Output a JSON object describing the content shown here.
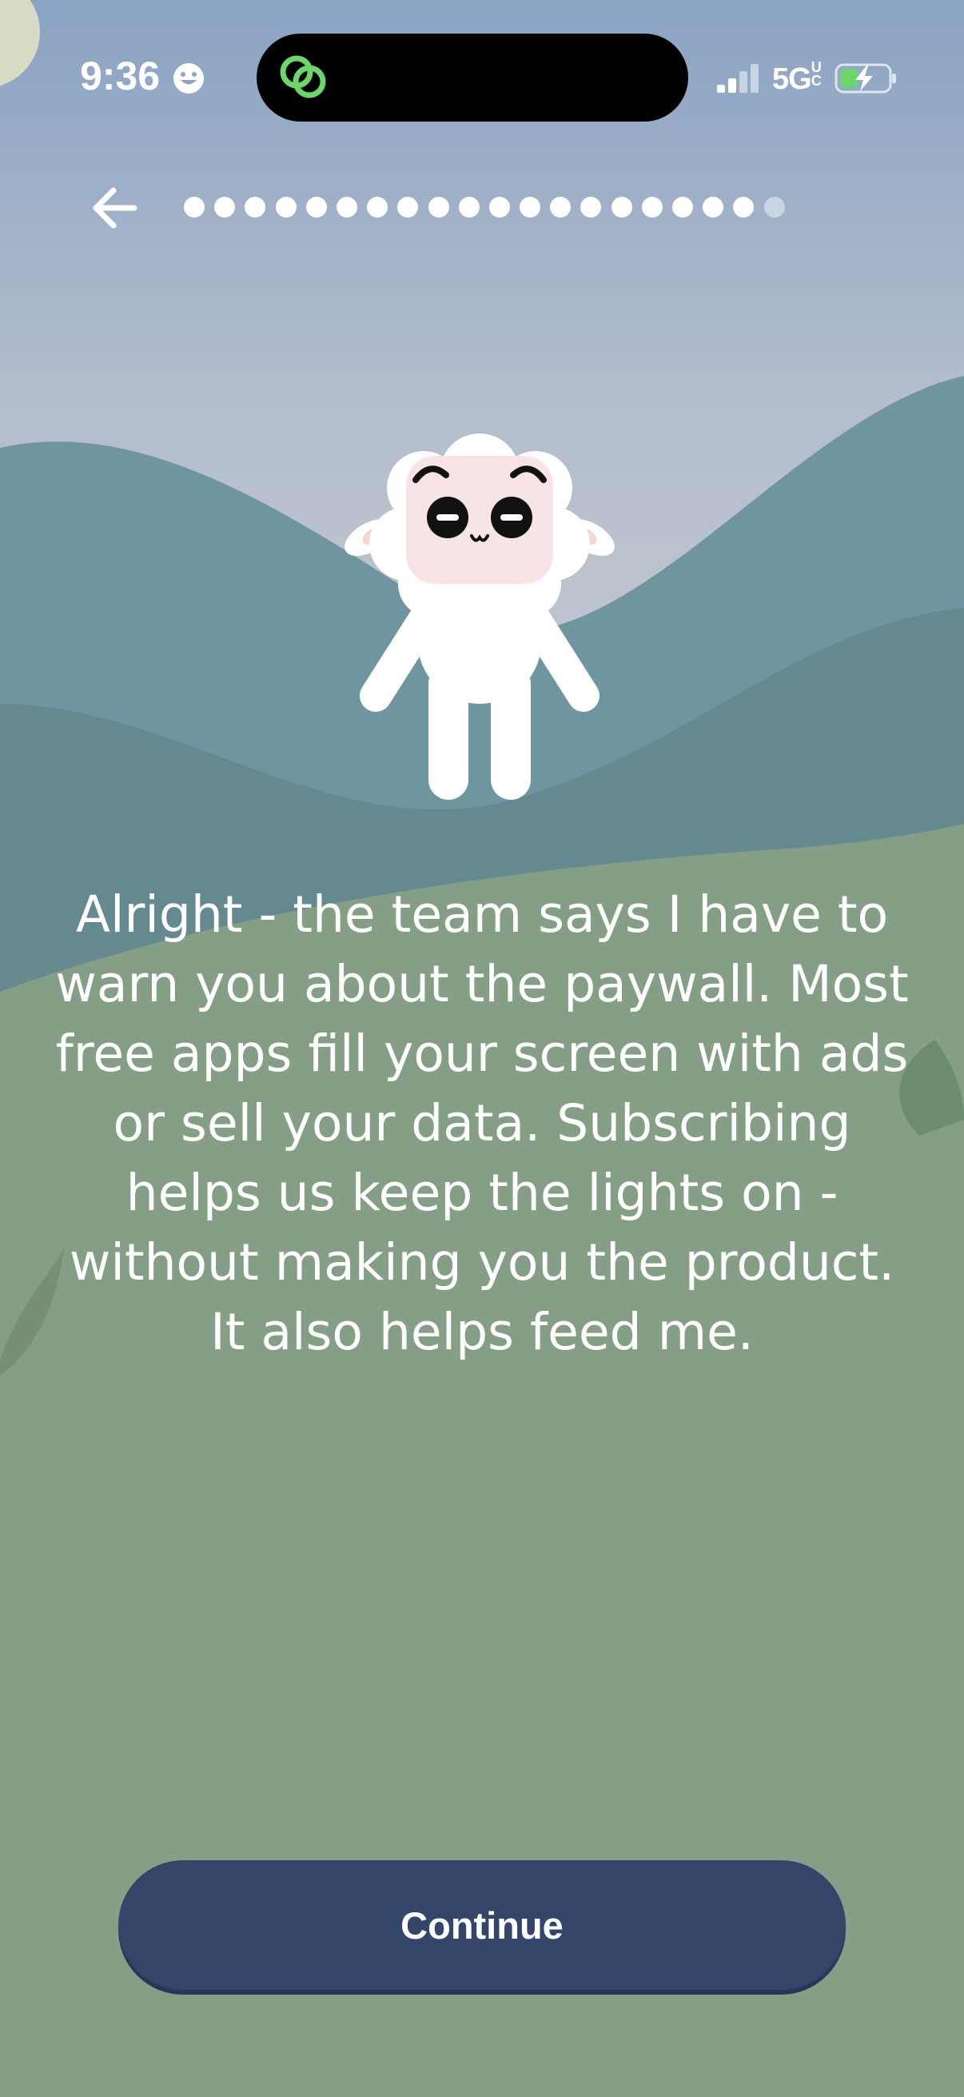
{
  "status_bar": {
    "time": "9:36",
    "network": "5G",
    "network_suffix": "UC",
    "status_emoji_icon": "smiley-face-icon",
    "signal_icon": "cellular-signal-icon",
    "battery_icon": "battery-charging-icon",
    "island_icon": "linked-rings-app-icon",
    "island_icon_color": "#6cd66b"
  },
  "nav": {
    "back_icon": "arrow-left-icon",
    "progress": {
      "total_steps": 20,
      "completed_steps": 19
    }
  },
  "mascot": {
    "icon": "sheep-mascot-icon"
  },
  "message": {
    "text": "Alright - the team says I have to warn you about the paywall. Most free apps fill your screen with ads or sell your data. Subscribing helps us keep the lights on - without making you the product. It also helps feed me."
  },
  "actions": {
    "continue_label": "Continue"
  },
  "colors": {
    "sky_top": "#8ea6c4",
    "hills_blue": "#6f95a1",
    "meadow": "#849f86",
    "button": "#33466a",
    "text": "#ffffff"
  }
}
